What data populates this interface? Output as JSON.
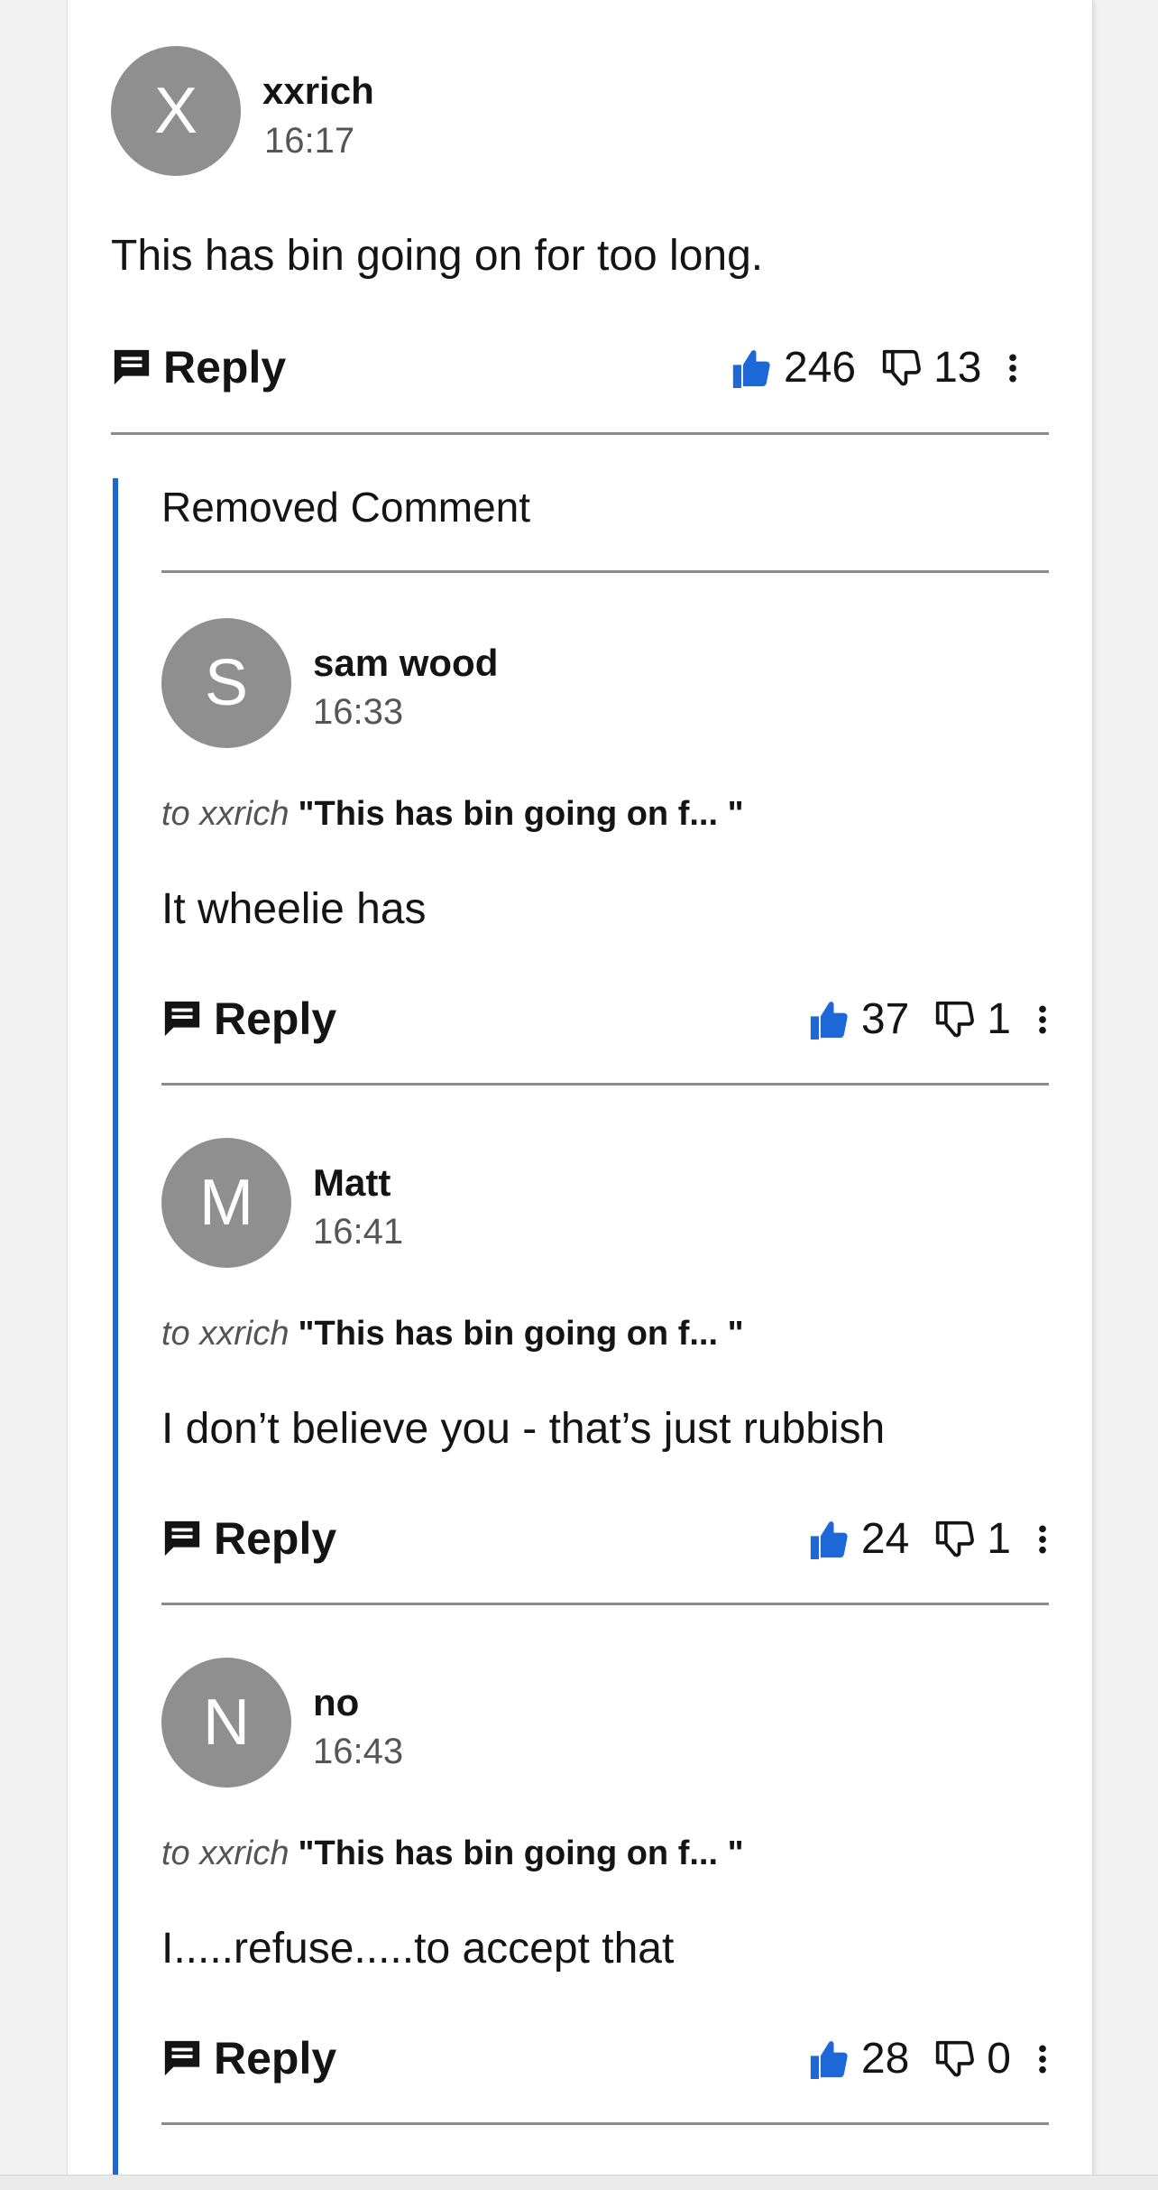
{
  "colors": {
    "accent": "#1c68d6",
    "avatar": "#8f8f8f",
    "rule": "#8a8a8a",
    "thumb_up_fill": "#1c68d6"
  },
  "icons": {
    "reply": "comment-bubble-icon",
    "like": "thumbs-up-icon",
    "dislike": "thumbs-down-icon",
    "more": "vertical-ellipsis-icon"
  },
  "top_comment": {
    "avatar_letter": "X",
    "author": "xxrich",
    "time": "16:17",
    "text": "This has bin going on for too long.",
    "reply_label": "Reply",
    "likes": "246",
    "dislikes": "13"
  },
  "removed_label": "Removed Comment",
  "replies": [
    {
      "avatar_letter": "S",
      "author": "sam wood",
      "time": "16:33",
      "to_label": "to xxrich",
      "quote": "\"This has bin going on f... \"",
      "text": "It wheelie has",
      "reply_label": "Reply",
      "likes": "37",
      "dislikes": "1"
    },
    {
      "avatar_letter": "M",
      "author": "Matt",
      "time": "16:41",
      "to_label": "to xxrich",
      "quote": "\"This has bin going on f... \"",
      "text": "I don’t believe you - that’s just rubbish",
      "reply_label": "Reply",
      "likes": "24",
      "dislikes": "1"
    },
    {
      "avatar_letter": "N",
      "author": "no",
      "time": "16:43",
      "to_label": "to xxrich",
      "quote": "\"This has bin going on f... \"",
      "text": "I.....refuse.....to accept that",
      "reply_label": "Reply",
      "likes": "28",
      "dislikes": "0"
    }
  ]
}
